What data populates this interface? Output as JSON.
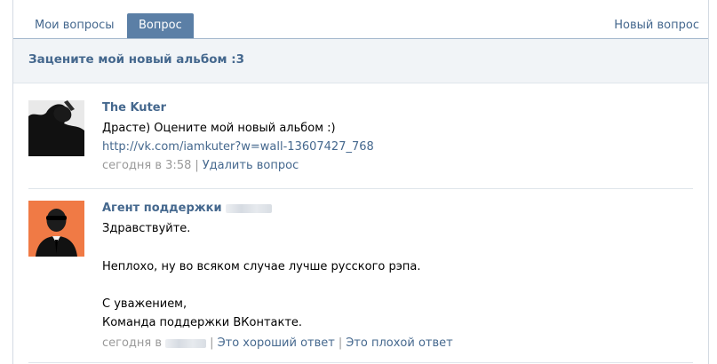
{
  "tabs": {
    "my_questions": "Мои вопросы",
    "question": "Вопрос",
    "new_question": "Новый вопрос"
  },
  "page_title": "Зацените мой новый альбом :3",
  "posts": [
    {
      "author": "The Kuter",
      "text": "Драсте) Оцените мой новый альбом :)",
      "link": "http://vk.com/iamkuter?w=wall-13607427_768",
      "time": "сегодня в 3:58",
      "action": "Удалить вопрос"
    },
    {
      "author": "Агент поддержки",
      "lines": [
        "Здравствуйте.",
        "Неплохо, ну во всяком случае лучше русского рэпа.",
        "С уважением,",
        "Команда поддержки ВКонтакте."
      ],
      "time_prefix": "сегодня в",
      "good": "Это хороший ответ",
      "bad": "Это плохой ответ"
    }
  ],
  "colors": {
    "link": "#45688e",
    "active_tab": "#5b7fa6",
    "title_bg": "#f1f4f7",
    "agent_bg": "#f07a45"
  },
  "icons": [
    "user-avatar-silhouette",
    "support-agent-avatar"
  ]
}
